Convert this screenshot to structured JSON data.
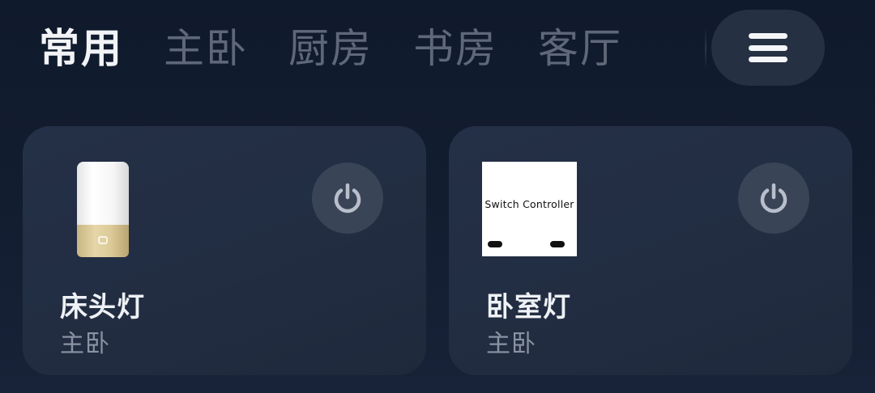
{
  "tabs": [
    {
      "label": "常用",
      "active": true
    },
    {
      "label": "主卧",
      "active": false
    },
    {
      "label": "厨房",
      "active": false
    },
    {
      "label": "书房",
      "active": false
    },
    {
      "label": "客厅",
      "active": false
    }
  ],
  "menu": {
    "icon": "hamburger-menu-icon"
  },
  "devices": [
    {
      "name": "床头灯",
      "room": "主卧",
      "image": "bedside-lamp-image",
      "power_icon": "power-icon"
    },
    {
      "name": "卧室灯",
      "room": "主卧",
      "image_text": "Switch Controller",
      "image": "switch-controller-image",
      "power_icon": "power-icon"
    }
  ],
  "colors": {
    "accent_text": "#f1f3f6",
    "inactive_tab": "#5f6878",
    "card_bg": "#232e44",
    "power_bg": "#3a4457"
  }
}
